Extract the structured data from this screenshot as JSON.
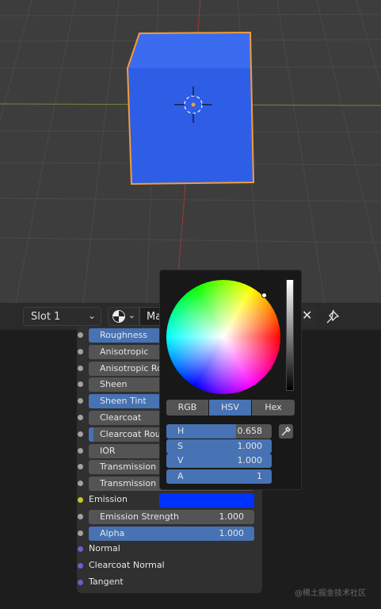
{
  "viewport": {
    "object_color": "#2f5fe0",
    "outline_color": "#f39c3a"
  },
  "header": {
    "slot_label": "Slot 1",
    "material_name": "Ma",
    "close_symbol": "✕"
  },
  "node": {
    "rows": [
      {
        "label": "Roughness",
        "type": "slider",
        "fill": 1.0,
        "socket": "gray"
      },
      {
        "label": "Anisotropic",
        "type": "slider",
        "fill": 0,
        "socket": "gray"
      },
      {
        "label": "Anisotropic Rot",
        "type": "slider",
        "fill": 0,
        "socket": "gray"
      },
      {
        "label": "Sheen",
        "type": "slider",
        "fill": 0,
        "socket": "gray"
      },
      {
        "label": "Sheen Tint",
        "type": "slider",
        "fill": 1.0,
        "socket": "gray"
      },
      {
        "label": "Clearcoat",
        "type": "slider",
        "fill": 0,
        "socket": "gray"
      },
      {
        "label": "Clearcoat Roug",
        "type": "slider",
        "fill": 0.03,
        "socket": "gray"
      },
      {
        "label": "IOR",
        "type": "slider",
        "fill": 0,
        "socket": "gray"
      },
      {
        "label": "Transmission",
        "type": "slider",
        "fill": 0,
        "socket": "gray"
      },
      {
        "label": "Transmission R",
        "type": "slider",
        "fill": 0,
        "socket": "gray"
      },
      {
        "label": "Emission",
        "type": "color",
        "color": "#0032ff",
        "socket": "yellow"
      },
      {
        "label": "Emission Strength",
        "value": "1.000",
        "type": "slider",
        "fill": 0,
        "socket": "gray"
      },
      {
        "label": "Alpha",
        "value": "1.000",
        "type": "slider",
        "fill": 1.0,
        "socket": "gray"
      },
      {
        "label": "Normal",
        "type": "plain",
        "socket": "purple"
      },
      {
        "label": "Clearcoat Normal",
        "type": "plain",
        "socket": "purple"
      },
      {
        "label": "Tangent",
        "type": "plain",
        "socket": "purple"
      }
    ]
  },
  "picker": {
    "tabs": [
      "RGB",
      "HSV",
      "Hex"
    ],
    "active_tab": "HSV",
    "fields": [
      {
        "label": "H",
        "value": "0.658"
      },
      {
        "label": "S",
        "value": "1.000"
      },
      {
        "label": "V",
        "value": "1.000"
      },
      {
        "label": "A",
        "value": "1"
      }
    ]
  },
  "watermark": "@稀土掘金技术社区"
}
